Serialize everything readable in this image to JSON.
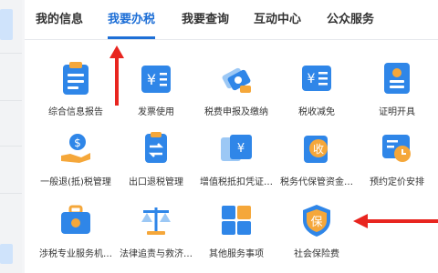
{
  "tabs": [
    {
      "label": "我的信息"
    },
    {
      "label": "我要办税"
    },
    {
      "label": "我要查询"
    },
    {
      "label": "互动中心"
    },
    {
      "label": "公众服务"
    }
  ],
  "active_tab": "我要办税",
  "services": [
    {
      "label": "综合信息报告",
      "icon": "report-clipboard-icon"
    },
    {
      "label": "发票使用",
      "icon": "invoice-yen-icon"
    },
    {
      "label": "税费申报及缴纳",
      "icon": "tax-declare-icon"
    },
    {
      "label": "税收减免",
      "icon": "tax-relief-icon"
    },
    {
      "label": "证明开具",
      "icon": "certificate-icon"
    },
    {
      "label": "一般退(抵)税管理",
      "icon": "refund-hand-icon"
    },
    {
      "label": "出口退税管理",
      "icon": "export-refund-icon"
    },
    {
      "label": "增值税抵扣凭证…",
      "icon": "vat-voucher-icon"
    },
    {
      "label": "税务代保管资金…",
      "icon": "custody-fund-icon"
    },
    {
      "label": "预约定价安排",
      "icon": "pricing-arrangement-icon"
    },
    {
      "label": "涉税专业服务机…",
      "icon": "briefcase-icon"
    },
    {
      "label": "法律追责与救济…",
      "icon": "scales-icon"
    },
    {
      "label": "其他服务事项",
      "icon": "grid-icon"
    },
    {
      "label": "社会保险费",
      "icon": "insurance-shield-icon"
    }
  ],
  "icon_glyphs": {
    "yen": "¥",
    "insurance": "保",
    "receive": "收"
  },
  "colors": {
    "accent": "#1e6fd6",
    "icon_blue": "#2f86e8",
    "icon_light": "#9cc8f5",
    "icon_orange": "#f5a73a",
    "arrow_red": "#e8251f"
  }
}
